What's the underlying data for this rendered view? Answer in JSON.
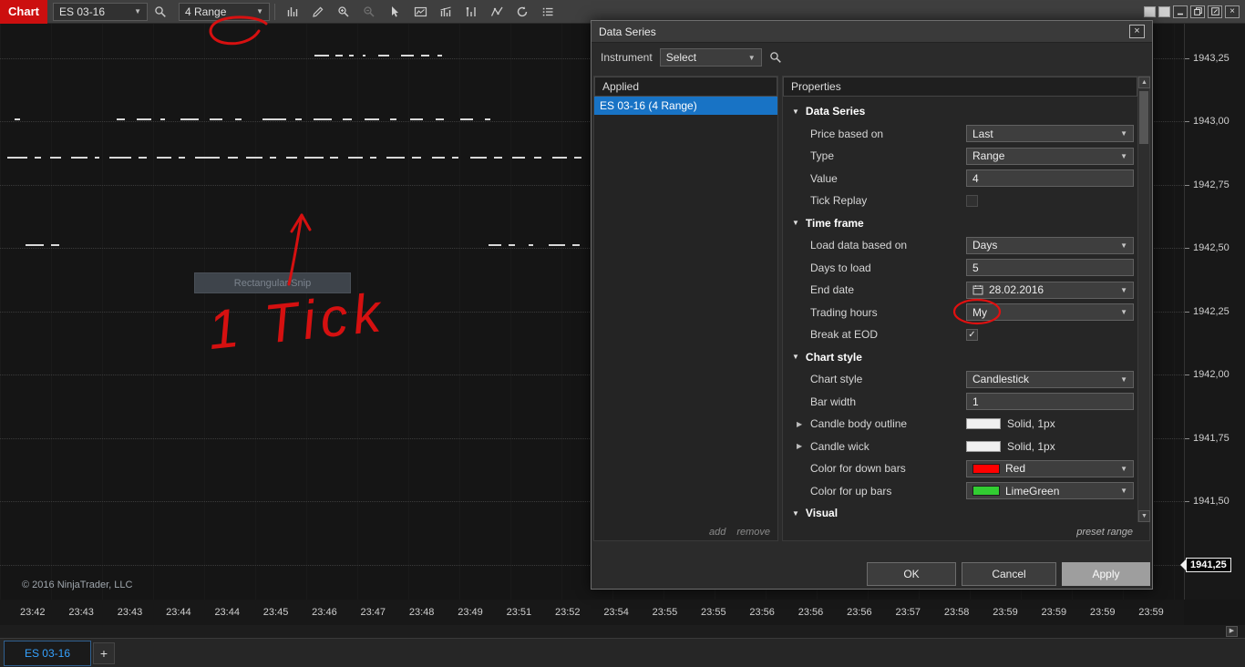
{
  "toolbar": {
    "chart_badge": "Chart",
    "instrument": "ES 03-16",
    "interval": "4 Range"
  },
  "price_axis": {
    "values": [
      "1943,25",
      "1943,00",
      "1942,75",
      "1942,50",
      "1942,25",
      "1942,00",
      "1941,75",
      "1941,50"
    ],
    "last": "1941,25"
  },
  "time_axis": [
    "23:42",
    "23:43",
    "23:43",
    "23:44",
    "23:44",
    "23:45",
    "23:46",
    "23:47",
    "23:48",
    "23:49",
    "23:51",
    "23:52",
    "23:54",
    "23:55",
    "23:55",
    "23:56",
    "23:56",
    "23:56",
    "23:57",
    "23:58",
    "23:59",
    "23:59",
    "23:59",
    "23:59"
  ],
  "chart": {
    "copyright": "© 2016 NinjaTrader, LLC",
    "snip_label": "Rectangular Snip",
    "annotation": "1 Tick",
    "bars": [
      [
        345,
        34,
        16
      ],
      [
        368,
        34,
        8
      ],
      [
        383,
        34,
        5
      ],
      [
        398,
        34,
        3
      ],
      [
        415,
        34,
        12
      ],
      [
        440,
        34,
        14
      ],
      [
        462,
        34,
        9
      ],
      [
        480,
        34,
        5
      ],
      [
        16,
        104,
        6
      ],
      [
        128,
        104,
        9
      ],
      [
        150,
        104,
        16
      ],
      [
        176,
        104,
        5
      ],
      [
        198,
        104,
        20
      ],
      [
        230,
        104,
        14
      ],
      [
        258,
        104,
        7
      ],
      [
        288,
        104,
        26
      ],
      [
        324,
        104,
        7
      ],
      [
        344,
        104,
        20
      ],
      [
        376,
        104,
        10
      ],
      [
        400,
        104,
        16
      ],
      [
        428,
        104,
        7
      ],
      [
        450,
        104,
        14
      ],
      [
        478,
        104,
        9
      ],
      [
        505,
        104,
        14
      ],
      [
        532,
        104,
        6
      ],
      [
        8,
        146,
        22
      ],
      [
        38,
        146,
        7
      ],
      [
        55,
        146,
        12
      ],
      [
        78,
        146,
        18
      ],
      [
        104,
        146,
        5
      ],
      [
        120,
        146,
        24
      ],
      [
        152,
        146,
        9
      ],
      [
        172,
        146,
        16
      ],
      [
        196,
        146,
        7
      ],
      [
        214,
        146,
        27
      ],
      [
        250,
        146,
        11
      ],
      [
        270,
        146,
        18
      ],
      [
        296,
        146,
        7
      ],
      [
        314,
        146,
        12
      ],
      [
        334,
        146,
        21
      ],
      [
        362,
        146,
        9
      ],
      [
        382,
        146,
        16
      ],
      [
        406,
        146,
        7
      ],
      [
        424,
        146,
        20
      ],
      [
        452,
        146,
        10
      ],
      [
        474,
        146,
        14
      ],
      [
        496,
        146,
        7
      ],
      [
        516,
        146,
        18
      ],
      [
        542,
        146,
        9
      ],
      [
        562,
        146,
        14
      ],
      [
        586,
        146,
        8
      ],
      [
        606,
        146,
        16
      ],
      [
        630,
        146,
        8
      ],
      [
        28,
        242,
        20
      ],
      [
        56,
        242,
        9
      ],
      [
        536,
        242,
        14
      ],
      [
        558,
        242,
        7
      ],
      [
        580,
        242,
        5
      ],
      [
        602,
        242,
        18
      ],
      [
        628,
        242,
        8
      ]
    ]
  },
  "tab_bar": {
    "tab": "ES 03-16",
    "add": "+"
  },
  "dialog": {
    "title": "Data Series",
    "instrument_label": "Instrument",
    "instrument_value": "Select",
    "applied_header": "Applied",
    "applied_items": [
      "ES 03-16 (4 Range)"
    ],
    "add_label": "add",
    "remove_label": "remove",
    "properties_header": "Properties",
    "preset_label": "preset range",
    "ok": "OK",
    "cancel": "Cancel",
    "apply": "Apply",
    "rows": [
      {
        "kind": "section",
        "label": "Data Series"
      },
      {
        "kind": "dropdown",
        "label": "Price based on",
        "value": "Last"
      },
      {
        "kind": "dropdown",
        "label": "Type",
        "value": "Range"
      },
      {
        "kind": "input",
        "label": "Value",
        "value": "4"
      },
      {
        "kind": "checkbox",
        "label": "Tick Replay",
        "checked": false
      },
      {
        "kind": "section",
        "label": "Time frame"
      },
      {
        "kind": "dropdown",
        "label": "Load data based on",
        "value": "Days"
      },
      {
        "kind": "input",
        "label": "Days to load",
        "value": "5"
      },
      {
        "kind": "dropdown-date",
        "label": "End date",
        "value": "28.02.2016"
      },
      {
        "kind": "dropdown",
        "label": "Trading hours",
        "value": "My"
      },
      {
        "kind": "checkbox",
        "label": "Break at EOD",
        "checked": true
      },
      {
        "kind": "section",
        "label": "Chart style"
      },
      {
        "kind": "dropdown",
        "label": "Chart style",
        "value": "Candlestick"
      },
      {
        "kind": "input",
        "label": "Bar width",
        "value": "1"
      },
      {
        "kind": "swatch",
        "label": "Candle body outline",
        "value": "Solid, 1px",
        "swatch": "#f0f0f0",
        "collapsed": true
      },
      {
        "kind": "swatch",
        "label": "Candle wick",
        "value": "Solid, 1px",
        "swatch": "#f0f0f0",
        "collapsed": true
      },
      {
        "kind": "dropdown-color",
        "label": "Color for down bars",
        "value": "Red",
        "swatch": "#ff0000"
      },
      {
        "kind": "dropdown-color",
        "label": "Color for up bars",
        "value": "LimeGreen",
        "swatch": "#32cd32"
      },
      {
        "kind": "section",
        "label": "Visual"
      }
    ]
  },
  "colors": {
    "down_bar": "#ff0000",
    "up_bar": "#32cd32",
    "annotation_red": "#e01010",
    "selection_blue": "#1873c5"
  }
}
